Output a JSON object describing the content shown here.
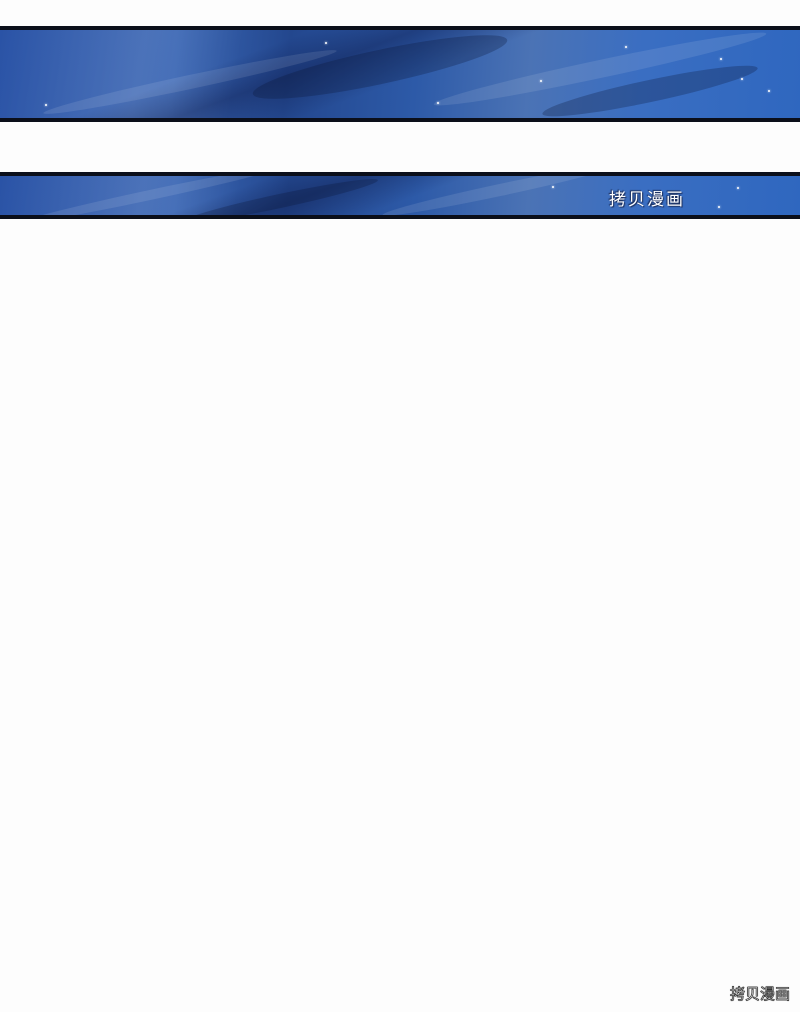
{
  "panels": {
    "top": {
      "description_colors": [
        "#2a53a6",
        "#23478e",
        "#4b73b5",
        "#0b0f1a"
      ]
    },
    "second": {
      "caption": "拷贝漫画"
    }
  },
  "watermark": {
    "text": "拷贝漫画"
  }
}
